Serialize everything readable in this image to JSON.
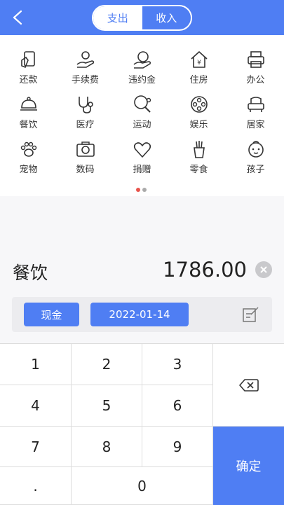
{
  "header": {
    "tabs": [
      "支出",
      "收入"
    ],
    "active_tab": 0
  },
  "categories": [
    "还款",
    "手续费",
    "违约金",
    "住房",
    "办公",
    "餐饮",
    "医疗",
    "运动",
    "娱乐",
    "居家",
    "宠物",
    "数码",
    "捐赠",
    "零食",
    "孩子"
  ],
  "icons": [
    "repay-icon",
    "fee-icon",
    "penalty-icon",
    "housing-icon",
    "office-icon",
    "dining-icon",
    "medical-icon",
    "sports-icon",
    "entertainment-icon",
    "home-icon",
    "pet-icon",
    "digital-icon",
    "donation-icon",
    "snack-icon",
    "child-icon"
  ],
  "page_dots": {
    "count": 2,
    "active": 0,
    "active_color": "#e8544c",
    "inactive_color": "#aaaaaa"
  },
  "entry": {
    "category": "餐饮",
    "amount": "1786.00"
  },
  "options": {
    "account": "现金",
    "date": "2022-01-14"
  },
  "keypad": {
    "keys": [
      "1",
      "2",
      "3",
      "4",
      "5",
      "6",
      "7",
      "8",
      "9",
      ".",
      "0"
    ],
    "confirm": "确定"
  },
  "colors": {
    "accent": "#4f7ef3"
  }
}
